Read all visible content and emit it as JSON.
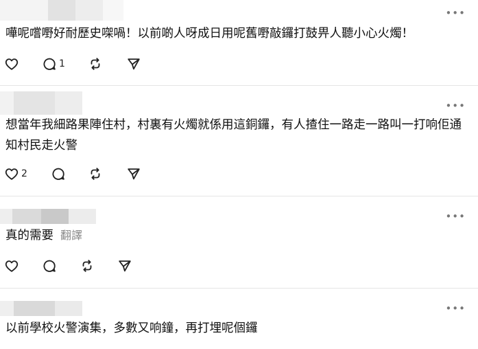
{
  "comments": [
    {
      "text": "嘩呢嚐嘢好耐歷史㗎喎！以前啲人呀成日用呢舊嘢敲鑼打鼓畀人聽小心火燭！",
      "translate": "",
      "likes": "",
      "replies": "1"
    },
    {
      "text": "想當年我細路果陣住村，村裏有火燭就係用這銅鑼，有人揸住一路走一路叫一打响佢通知村民走火警",
      "translate": "",
      "likes": "2",
      "replies": ""
    },
    {
      "text": "真的需要",
      "translate": "翻譯",
      "likes": "",
      "replies": ""
    },
    {
      "text": "以前學校火警演集，多數又响鐘，再打埋呢個鑼",
      "translate": "",
      "likes": "",
      "replies": ""
    }
  ],
  "icons": {
    "like": "heart-icon",
    "reply": "comment-icon",
    "repost": "repost-icon",
    "share": "send-icon",
    "more": "more-options-icon"
  },
  "more_label": "•••"
}
